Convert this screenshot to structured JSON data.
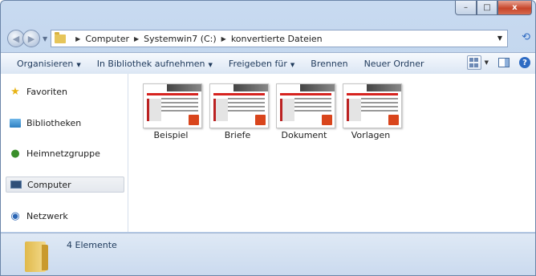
{
  "window": {
    "controls": {
      "minimize": "–",
      "maximize": "□",
      "close": "x"
    }
  },
  "address": {
    "crumbs": [
      "Computer",
      "Systemwin7 (C:)",
      "konvertierte Dateien"
    ]
  },
  "toolbar": {
    "organize": "Organisieren",
    "include_library": "In Bibliothek aufnehmen",
    "share": "Freigeben für",
    "burn": "Brennen",
    "new_folder": "Neuer Ordner"
  },
  "nav": {
    "items": [
      {
        "label": "Favoriten",
        "icon": "star-icon"
      },
      {
        "label": "Bibliotheken",
        "icon": "library-icon"
      },
      {
        "label": "Heimnetzgruppe",
        "icon": "homegroup-icon"
      },
      {
        "label": "Computer",
        "icon": "computer-icon"
      },
      {
        "label": "Netzwerk",
        "icon": "network-icon"
      }
    ]
  },
  "files": [
    {
      "name": "Beispiel"
    },
    {
      "name": "Briefe"
    },
    {
      "name": "Dokument"
    },
    {
      "name": "Vorlagen"
    }
  ],
  "status": {
    "count": "4 Elemente"
  }
}
